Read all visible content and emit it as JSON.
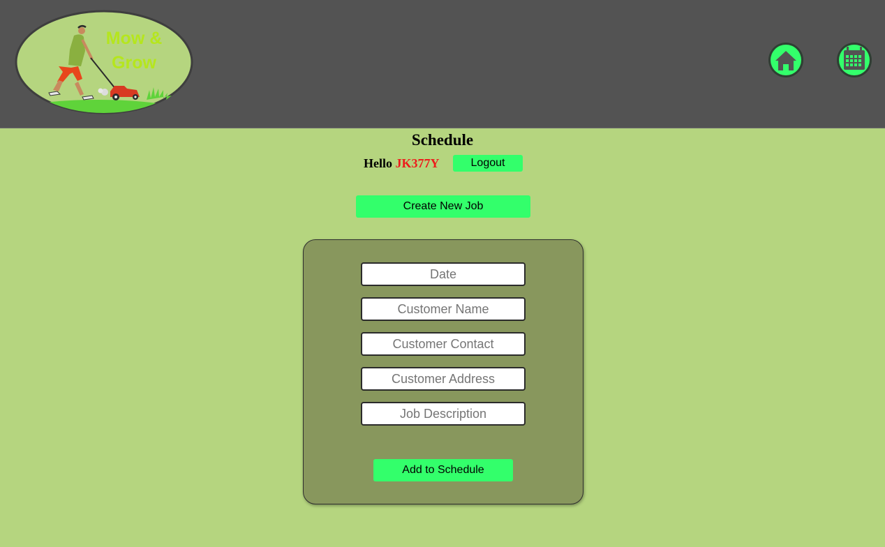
{
  "header": {
    "logo_text_line1": "Mow &",
    "logo_text_line2": "Grow",
    "nav": [
      {
        "name": "home",
        "icon": "home-icon"
      },
      {
        "name": "calendar",
        "icon": "calendar-icon"
      }
    ]
  },
  "page": {
    "title": "Schedule",
    "greeting": "Hello",
    "username": "JK377Y",
    "logout_label": "Logout",
    "create_label": "Create New Job"
  },
  "form": {
    "date_placeholder": "Date",
    "name_placeholder": "Customer Name",
    "contact_placeholder": "Customer Contact",
    "address_placeholder": "Customer Address",
    "description_placeholder": "Job Description",
    "submit_label": "Add to Schedule"
  },
  "colors": {
    "header_bg": "#535353",
    "page_bg": "#b5d57f",
    "accent_green": "#33ff6b",
    "panel_bg": "#88975d",
    "username_red": "#ee1b1b",
    "logo_text": "#b5e61d"
  }
}
